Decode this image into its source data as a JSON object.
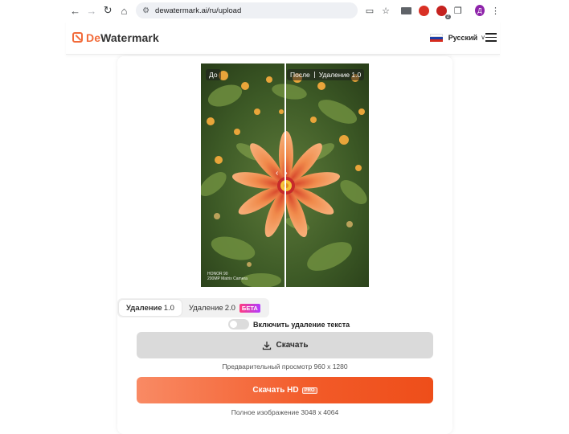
{
  "browser": {
    "url": "dewatermark.ai/ru/upload",
    "back_icon": "arrow-left-icon",
    "forward_icon": "arrow-right-icon",
    "reload_icon": "reload-icon",
    "home_icon": "home-icon",
    "extension_badge": "2",
    "profile_initial": "Д"
  },
  "header": {
    "logo_prefix": "De",
    "logo_suffix": "Watermark",
    "language": "Русский",
    "accent_color": "#f26b3a"
  },
  "preview": {
    "before_label": "До",
    "after_label": "После",
    "after_mode": "Удаление 1.0",
    "watermark_line1": "HONOR 90",
    "watermark_line2": "200MP Matrix Camera"
  },
  "tabs": [
    {
      "label": "Удаление",
      "version": "1.0",
      "active": true
    },
    {
      "label": "Удаление",
      "version": "2.0",
      "badge": "БЕТА",
      "active": false
    }
  ],
  "text_removal": {
    "label": "Включить удаление текста",
    "enabled": false
  },
  "download": {
    "label": "Скачать",
    "caption": "Предварительный просмотр 960 x 1280"
  },
  "download_hd": {
    "label": "Скачать HD",
    "badge": "PRO",
    "caption": "Полное изображение 3048 x 4064"
  }
}
